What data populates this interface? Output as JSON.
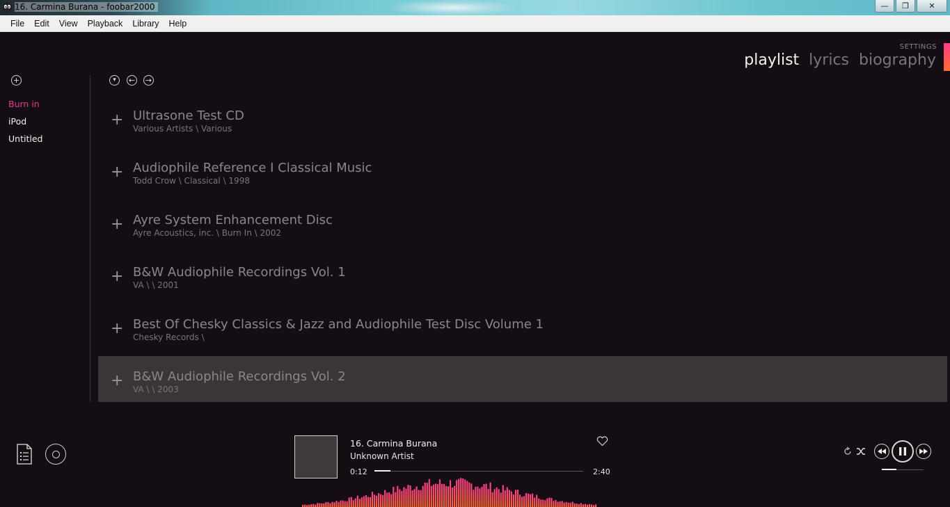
{
  "window": {
    "title": "16. Carmina Burana - foobar2000",
    "minimize": "—",
    "maximize": "❐",
    "close": "✕"
  },
  "menu": [
    "File",
    "Edit",
    "View",
    "Playback",
    "Library",
    "Help"
  ],
  "header": {
    "settings": "SETTINGS",
    "tabs": [
      {
        "label": "playlist",
        "active": true
      },
      {
        "label": "lyrics",
        "active": false
      },
      {
        "label": "biography",
        "active": false
      }
    ]
  },
  "sidebar": {
    "add": "+",
    "playlists": [
      {
        "label": "Burn in",
        "active": true
      },
      {
        "label": "iPod",
        "active": false
      },
      {
        "label": "Untitled",
        "active": false
      }
    ]
  },
  "toolbar": {
    "dropdown": "▾",
    "back": "←",
    "forward": "→"
  },
  "albums": [
    {
      "title": "Ultrasone Test CD",
      "meta": "Various Artists  \\ Various",
      "selected": false
    },
    {
      "title": "Audiophile Reference I Classical Music",
      "meta": "Todd Crow  \\ Classical \\ 1998",
      "selected": false
    },
    {
      "title": "Ayre System Enhancement Disc",
      "meta": "Ayre Acoustics, inc.  \\ Burn In \\ 2002",
      "selected": false
    },
    {
      "title": "B&W Audiophile Recordings Vol. 1",
      "meta": "VA  \\  \\ 2001",
      "selected": false
    },
    {
      "title": "Best Of Chesky Classics & Jazz and Audiophile Test Disc Volume 1",
      "meta": "Chesky Records  \\ ",
      "selected": false
    },
    {
      "title": "B&W Audiophile Recordings Vol. 2",
      "meta": "VA  \\  \\ 2003",
      "selected": true
    }
  ],
  "row_expand_glyph": "+",
  "now_playing": {
    "title": "16. Carmina Burana",
    "artist": "Unknown Artist",
    "elapsed": "0:12",
    "duration": "2:40",
    "progress": 0.075,
    "volume": 0.35
  },
  "colors": {
    "accent": "#e9398e",
    "accent_gradient_end": "#ff6a2f",
    "background": "#150d14"
  },
  "icons": {
    "playlist_view": "playlist-icon",
    "disc_view": "disc-icon",
    "favorite": "heart-icon",
    "repeat": "repeat-icon",
    "shuffle": "shuffle-icon",
    "prev": "rewind-icon",
    "pause": "pause-icon",
    "next": "fast-forward-icon"
  }
}
